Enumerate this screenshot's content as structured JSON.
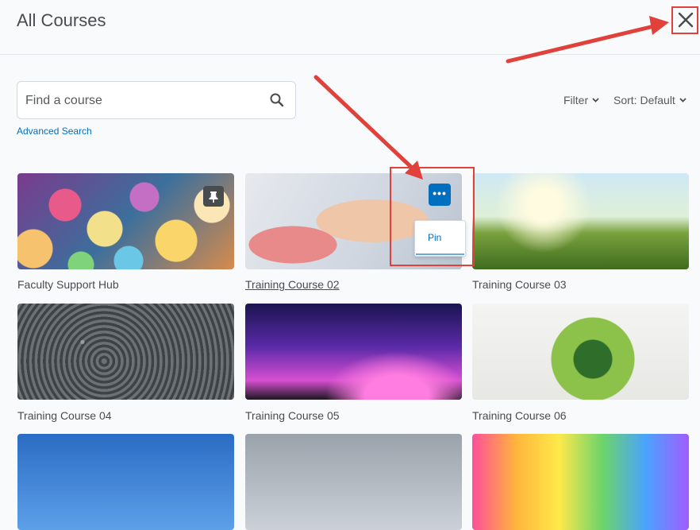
{
  "header": {
    "title": "All Courses"
  },
  "search": {
    "placeholder": "Find a course",
    "advanced_label": "Advanced Search"
  },
  "toolbar": {
    "filter_label": "Filter",
    "sort_label": "Sort: Default"
  },
  "courses": [
    {
      "title": "Faculty Support Hub",
      "pinned": true
    },
    {
      "title": "Training Course 02",
      "pinned": false
    },
    {
      "title": "Training Course 03",
      "pinned": false
    },
    {
      "title": "Training Course 04",
      "pinned": false
    },
    {
      "title": "Training Course 05",
      "pinned": false
    },
    {
      "title": "Training Course 06",
      "pinned": false
    }
  ],
  "context_menu": {
    "pin_label": "Pin"
  },
  "colors": {
    "accent": "#006fbf",
    "annotation": "#e0413b",
    "text": "#494c4e"
  }
}
